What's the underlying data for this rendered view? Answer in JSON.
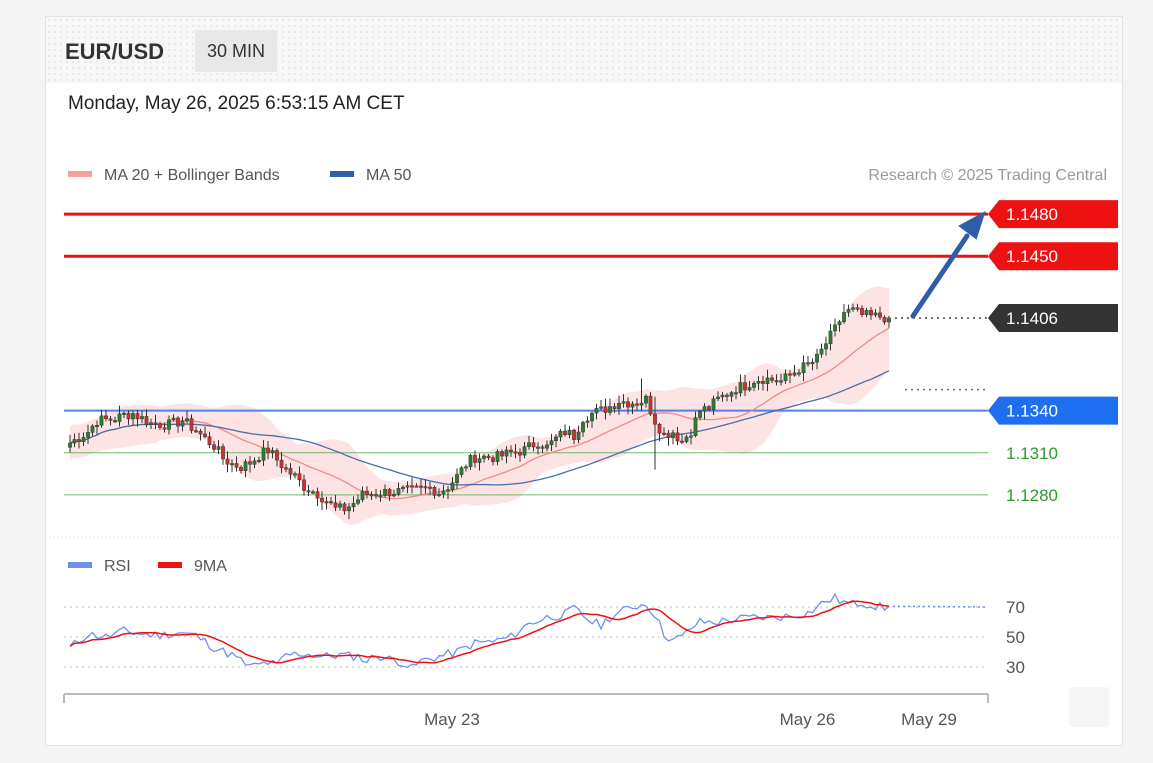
{
  "header": {
    "pair": "EUR/USD",
    "timeframe": "30 MIN"
  },
  "datetime": "Monday, May 26, 2025 6:53:15 AM CET",
  "legend": {
    "ma20": "MA 20 + Bollinger Bands",
    "ma50": "MA 50",
    "credit": "Research © 2025 Trading Central"
  },
  "rsi_legend": {
    "rsi": "RSI",
    "ma9": "9MA"
  },
  "colors": {
    "resistance": "#ee1111",
    "pivot": "#4f7ff0",
    "support": "#2e9a2e",
    "last": "#333333",
    "candle_up": "#2e7d32",
    "candle_down": "#d32f2f",
    "band": "#fde3e3",
    "ma20": "#f08a8a",
    "ma50": "#4a6ea8",
    "arrow": "#2f5ea8",
    "rsi": "#6f8ff0",
    "rsi_ma": "#ee1111"
  },
  "chart_data": {
    "type": "candlestick",
    "ylim": [
      1.1255,
      1.1495
    ],
    "levels": [
      {
        "label": "1.1480",
        "value": 1.148,
        "kind": "resistance"
      },
      {
        "label": "1.1450",
        "value": 1.145,
        "kind": "resistance"
      },
      {
        "label": "1.1406",
        "value": 1.1406,
        "kind": "last"
      },
      {
        "label": "1.1340",
        "value": 1.134,
        "kind": "pivot"
      },
      {
        "label": "1.1310",
        "value": 1.131,
        "kind": "support"
      },
      {
        "label": "1.1280",
        "value": 1.128,
        "kind": "support"
      }
    ],
    "x_ticks": [
      {
        "label": "May 23",
        "index": 78
      },
      {
        "label": "May 26",
        "index": 157
      },
      {
        "label": "May 29",
        "index": 184
      }
    ],
    "ohlc_anchors": [
      [
        0,
        1.1317
      ],
      [
        4,
        1.1325
      ],
      [
        6,
        1.1333
      ],
      [
        10,
        1.1334
      ],
      [
        12,
        1.1337
      ],
      [
        14,
        1.1338
      ],
      [
        18,
        1.1331
      ],
      [
        22,
        1.133
      ],
      [
        25,
        1.1333
      ],
      [
        28,
        1.1326
      ],
      [
        30,
        1.132
      ],
      [
        32,
        1.1315
      ],
      [
        34,
        1.1306
      ],
      [
        36,
        1.1302
      ],
      [
        38,
        1.13
      ],
      [
        40,
        1.1303
      ],
      [
        42,
        1.1308
      ],
      [
        44,
        1.1312
      ],
      [
        46,
        1.1305
      ],
      [
        48,
        1.1298
      ],
      [
        50,
        1.1293
      ],
      [
        52,
        1.1286
      ],
      [
        55,
        1.1281
      ],
      [
        57,
        1.1276
      ],
      [
        59,
        1.127
      ],
      [
        61,
        1.127
      ],
      [
        63,
        1.1274
      ],
      [
        65,
        1.128
      ],
      [
        70,
        1.1282
      ],
      [
        76,
        1.1283
      ],
      [
        80,
        1.1285
      ],
      [
        82,
        1.1282
      ],
      [
        84,
        1.1286
      ],
      [
        86,
        1.1293
      ],
      [
        88,
        1.1302
      ],
      [
        90,
        1.1307
      ],
      [
        95,
        1.1307
      ],
      [
        98,
        1.131
      ],
      [
        101,
        1.1312
      ],
      [
        104,
        1.1318
      ],
      [
        106,
        1.1314
      ],
      [
        108,
        1.132
      ],
      [
        110,
        1.1325
      ],
      [
        112,
        1.1322
      ],
      [
        114,
        1.1335
      ],
      [
        116,
        1.1338
      ],
      [
        118,
        1.134
      ],
      [
        120,
        1.1343
      ],
      [
        122,
        1.1347
      ],
      [
        124,
        1.1346
      ],
      [
        126,
        1.1346
      ],
      [
        128,
        1.1348
      ],
      [
        130,
        1.1333
      ],
      [
        132,
        1.1323
      ],
      [
        134,
        1.1325
      ],
      [
        136,
        1.1318
      ],
      [
        138,
        1.1326
      ],
      [
        140,
        1.134
      ],
      [
        142,
        1.1342
      ],
      [
        144,
        1.1348
      ],
      [
        146,
        1.1352
      ],
      [
        148,
        1.1356
      ],
      [
        150,
        1.1358
      ],
      [
        152,
        1.1362
      ],
      [
        154,
        1.1363
      ],
      [
        158,
        1.1361
      ],
      [
        160,
        1.1365
      ],
      [
        162,
        1.137
      ],
      [
        164,
        1.1372
      ],
      [
        166,
        1.1377
      ],
      [
        168,
        1.1388
      ],
      [
        170,
        1.1398
      ],
      [
        172,
        1.141
      ],
      [
        174,
        1.1411
      ],
      [
        176,
        1.1408
      ],
      [
        178,
        1.1407
      ],
      [
        180,
        1.1407
      ],
      [
        182,
        1.1406
      ]
    ],
    "rsi": {
      "ylim": [
        20,
        80
      ],
      "ticks": [
        70,
        50,
        30
      ],
      "anchors": [
        [
          0,
          43
        ],
        [
          4,
          52
        ],
        [
          8,
          50
        ],
        [
          12,
          54
        ],
        [
          16,
          52
        ],
        [
          20,
          51
        ],
        [
          24,
          53
        ],
        [
          28,
          51
        ],
        [
          32,
          43
        ],
        [
          36,
          38
        ],
        [
          40,
          30
        ],
        [
          44,
          33
        ],
        [
          46,
          31
        ],
        [
          48,
          38
        ],
        [
          52,
          39
        ],
        [
          56,
          37
        ],
        [
          60,
          38
        ],
        [
          64,
          37
        ],
        [
          66,
          34
        ],
        [
          68,
          38
        ],
        [
          70,
          36
        ],
        [
          74,
          33
        ],
        [
          76,
          29
        ],
        [
          78,
          34
        ],
        [
          82,
          37
        ],
        [
          86,
          40
        ],
        [
          90,
          46
        ],
        [
          94,
          47
        ],
        [
          98,
          50
        ],
        [
          102,
          59
        ],
        [
          106,
          63
        ],
        [
          110,
          65
        ],
        [
          112,
          69
        ],
        [
          116,
          60
        ],
        [
          118,
          58
        ],
        [
          120,
          63
        ],
        [
          124,
          69
        ],
        [
          126,
          71
        ],
        [
          128,
          72
        ],
        [
          130,
          65
        ],
        [
          132,
          52
        ],
        [
          134,
          48
        ],
        [
          136,
          50
        ],
        [
          138,
          56
        ],
        [
          140,
          60
        ],
        [
          144,
          60
        ],
        [
          148,
          62
        ],
        [
          152,
          63
        ],
        [
          156,
          63
        ],
        [
          160,
          64
        ],
        [
          164,
          66
        ],
        [
          166,
          70
        ],
        [
          168,
          74
        ],
        [
          170,
          76
        ],
        [
          172,
          73
        ],
        [
          174,
          72
        ],
        [
          176,
          73
        ],
        [
          180,
          70
        ],
        [
          182,
          69
        ]
      ]
    }
  }
}
